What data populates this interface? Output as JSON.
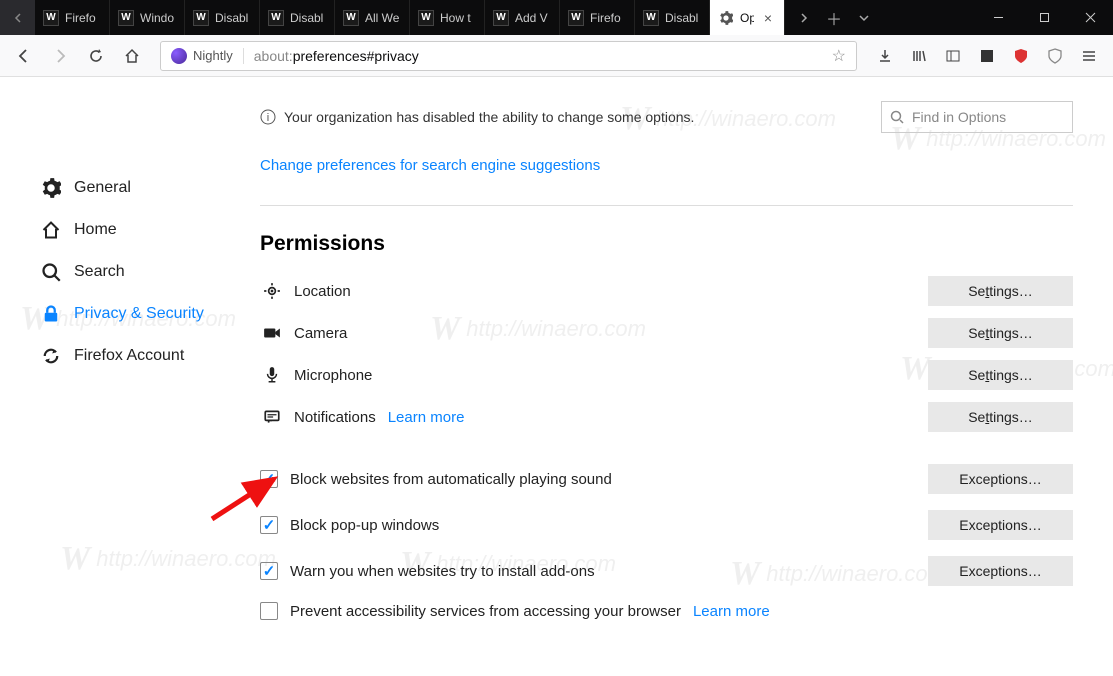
{
  "tabs": [
    {
      "label": "Firefo"
    },
    {
      "label": "Windo"
    },
    {
      "label": "Disabl"
    },
    {
      "label": "Disabl"
    },
    {
      "label": "All We"
    },
    {
      "label": "How t"
    },
    {
      "label": "Add V"
    },
    {
      "label": "Firefo"
    },
    {
      "label": "Disabl"
    },
    {
      "label": "Op",
      "active": true
    }
  ],
  "toolbar": {
    "identity": "Nightly",
    "url_prefix": "about:",
    "url_path": "preferences#privacy"
  },
  "notice": "Your organization has disabled the ability to change some options.",
  "search_placeholder": "Find in Options",
  "link_search_engine": "Change preferences for search engine suggestions",
  "sidebar": {
    "items": [
      {
        "label": "General"
      },
      {
        "label": "Home"
      },
      {
        "label": "Search"
      },
      {
        "label": "Privacy & Security"
      },
      {
        "label": "Firefox Account"
      }
    ]
  },
  "permissions": {
    "heading": "Permissions",
    "location": "Location",
    "camera": "Camera",
    "microphone": "Microphone",
    "notifications": "Notifications",
    "learn_more": "Learn more",
    "settings_btn": "Settings…",
    "exceptions_btn": "Exceptions…",
    "cb_autoplay": "Block websites from automatically playing sound",
    "cb_popup": "Block pop-up windows",
    "cb_addons": "Warn you when websites try to install add-ons",
    "cb_access": "Prevent accessibility services from accessing your browser"
  },
  "watermark": "http://winaero.com"
}
